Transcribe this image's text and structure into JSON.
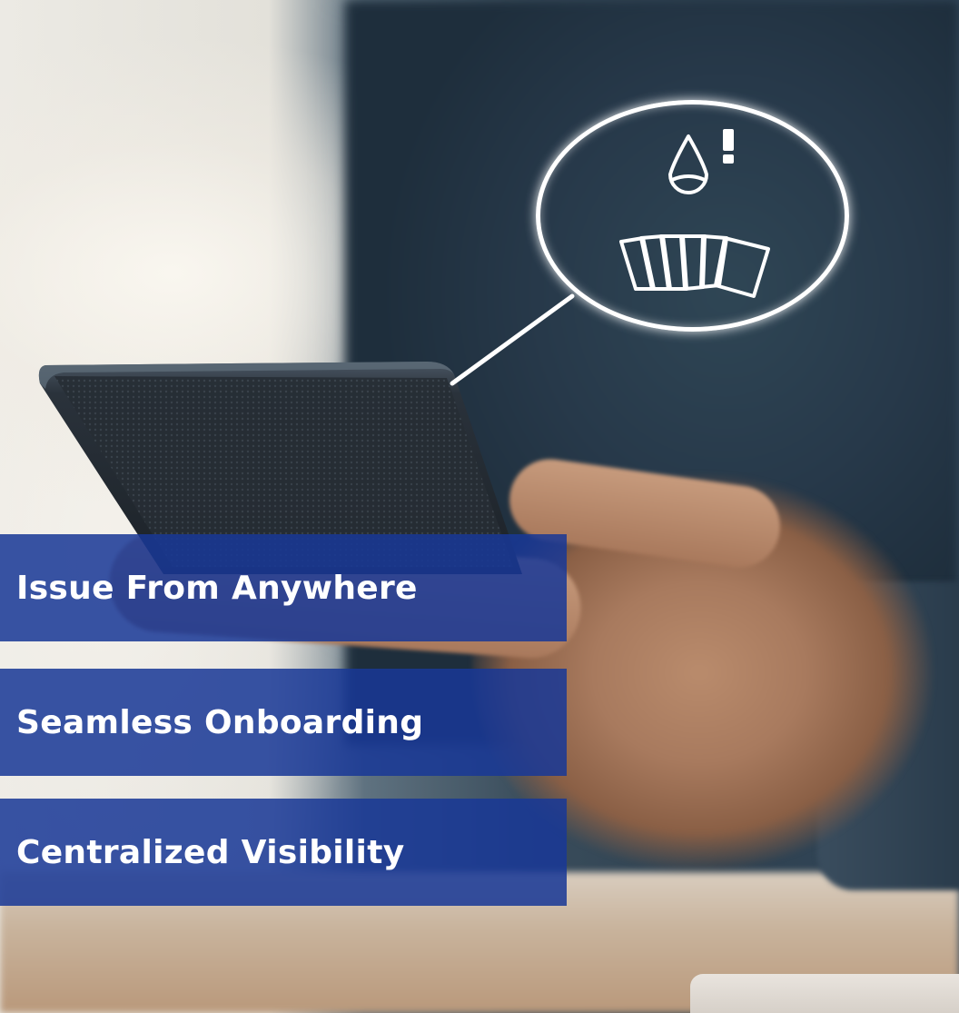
{
  "features": [
    {
      "label": "Issue From Anywhere"
    },
    {
      "label": "Seamless Onboarding"
    },
    {
      "label": "Centralized Visibility"
    }
  ],
  "callout": {
    "icons": [
      "ink-drop-alert-icon",
      "card-stack-icon"
    ]
  },
  "colors": {
    "label_background": "#1838a0",
    "label_text": "#ffffff",
    "callout_outline": "#ffffff"
  }
}
